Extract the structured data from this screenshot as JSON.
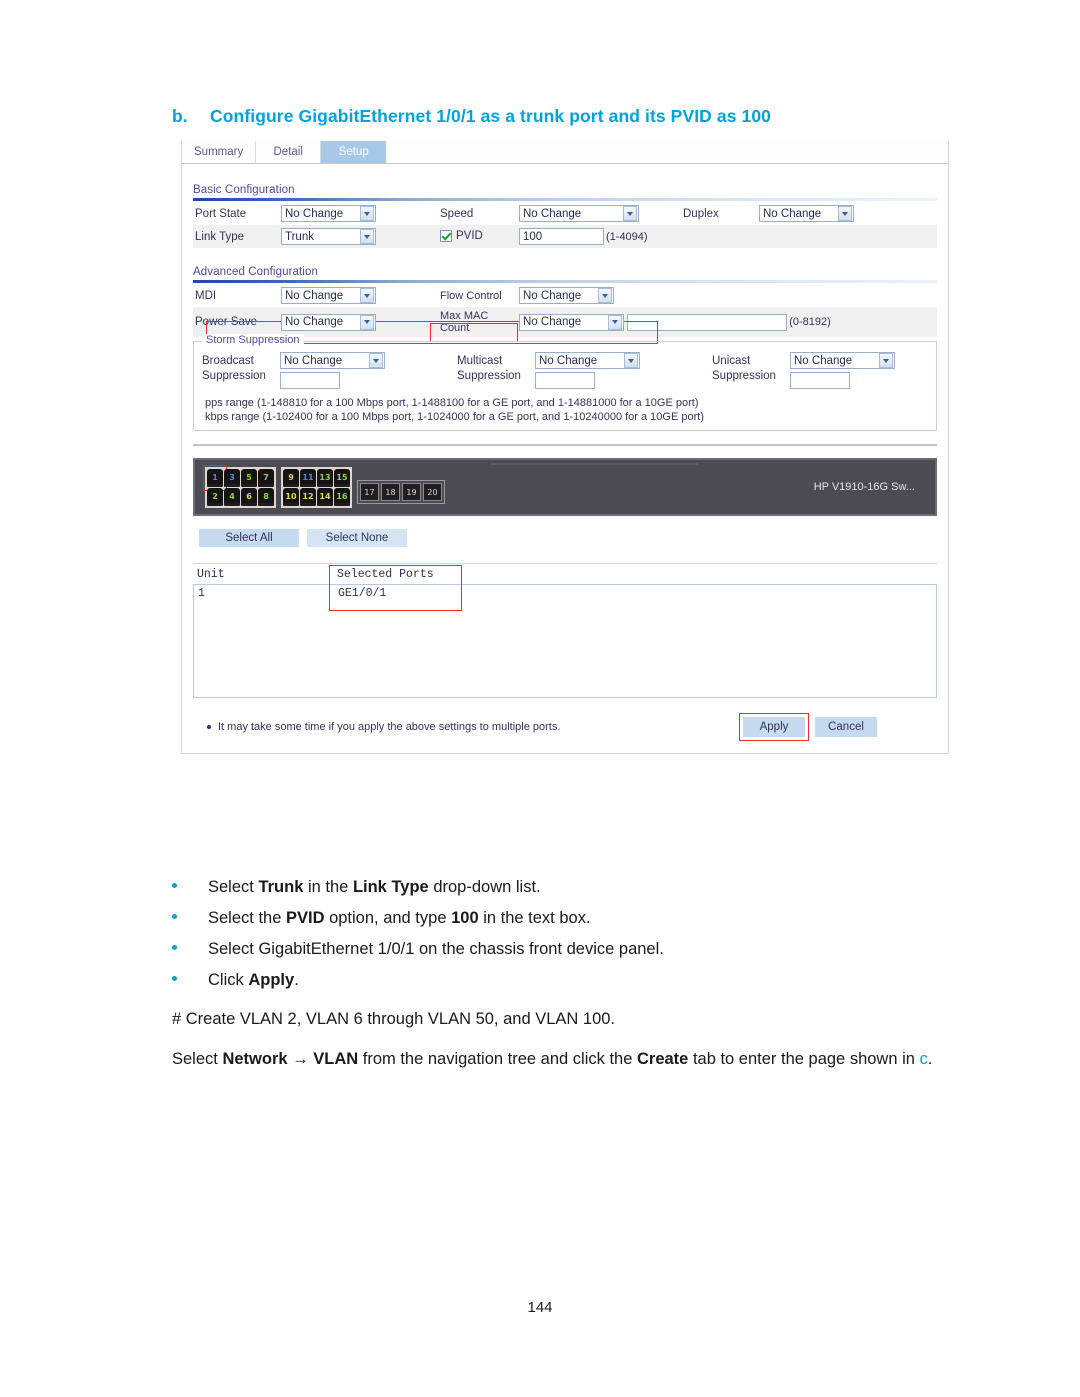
{
  "heading": {
    "label": "b.",
    "text": "Configure GigabitEthernet 1/0/1 as a trunk port and its PVID as 100"
  },
  "tabs": [
    {
      "label": "Summary",
      "active": false
    },
    {
      "label": "Detail",
      "active": false
    },
    {
      "label": "Setup",
      "active": true
    }
  ],
  "basic": {
    "title": "Basic Configuration",
    "port_state_label": "Port State",
    "port_state_value": "No Change",
    "speed_label": "Speed",
    "speed_value": "No Change",
    "duplex_label": "Duplex",
    "duplex_value": "No Change",
    "link_type_label": "Link Type",
    "link_type_value": "Trunk",
    "pvid_label": "PVID",
    "pvid_value": "100",
    "pvid_range": "(1-4094)"
  },
  "advanced": {
    "title": "Advanced Configuration",
    "mdi_label": "MDI",
    "mdi_value": "No Change",
    "flow_control_label": "Flow Control",
    "flow_control_value": "No Change",
    "power_save_label": "Power Save",
    "power_save_value": "No Change",
    "max_mac_label": "Max MAC Count",
    "max_mac_value": "No Change",
    "max_mac_text": "",
    "max_mac_range": "(0-8192)"
  },
  "storm": {
    "legend": "Storm Suppression",
    "broadcast_label": "Broadcast Suppression",
    "broadcast_value": "No Change",
    "broadcast_text": "",
    "multicast_label": "Multicast Suppression",
    "multicast_value": "No Change",
    "multicast_text": "",
    "unicast_label": "Unicast Suppression",
    "unicast_value": "No Change",
    "unicast_text": "",
    "pps_range": "pps range (1-148810 for a 100 Mbps port, 1-1488100 for a GE port, and 1-14881000 for a 10GE port)",
    "kbps_range": "kbps range (1-102400 for a 100 Mbps port, 1-1024000 for a GE port, and 1-10240000 for a 10GE port)"
  },
  "device": {
    "model": "HP V1910-16G Sw...",
    "group1_top": [
      "1",
      "3",
      "5",
      "7"
    ],
    "group1_bottom": [
      "2",
      "4",
      "6",
      "8"
    ],
    "group2_top": [
      "9",
      "11",
      "13",
      "15"
    ],
    "group2_bottom": [
      "10",
      "12",
      "14",
      "16"
    ],
    "sfp_ports": [
      "17",
      "18",
      "19",
      "20"
    ],
    "selected_port": "1"
  },
  "select_buttons": {
    "select_all": "Select All",
    "select_none": "Select None"
  },
  "selected_table": {
    "col_unit": "Unit",
    "col_ports": "Selected Ports",
    "rows": [
      {
        "unit": "1",
        "ports": "GE1/0/1"
      }
    ]
  },
  "footer": {
    "note": "It may take some time if you apply the above settings to multiple ports.",
    "apply": "Apply",
    "cancel": "Cancel"
  },
  "prose": {
    "b1_pre": "Select ",
    "b1_b1": "Trunk",
    "b1_mid": " in the ",
    "b1_b2": "Link Type",
    "b1_post": " drop-down list.",
    "b2_pre": "Select the ",
    "b2_b1": "PVID",
    "b2_mid": " option, and type ",
    "b2_b2": "100",
    "b2_post": " in the text box.",
    "b3": "Select GigabitEthernet 1/0/1 on the chassis front device panel.",
    "b4_pre": "Click ",
    "b4_b1": "Apply",
    "b4_post": ".",
    "p1": "# Create VLAN 2, VLAN 6 through VLAN 50, and VLAN 100.",
    "p2_pre": "Select ",
    "p2_b1": "Network",
    "p2_arrow": " → ",
    "p2_b2": "VLAN",
    "p2_mid": " from the navigation tree and click the ",
    "p2_b3": "Create",
    "p2_post": " tab to enter the page shown in ",
    "p2_link": "c",
    "p2_end": "."
  },
  "page_number": "144",
  "colors": {
    "accent": "#00a3d9",
    "tab_active_bg": "#a8c8e8",
    "highlight_red": "#ef2b2b",
    "button_blue": "#c5d9ef"
  }
}
